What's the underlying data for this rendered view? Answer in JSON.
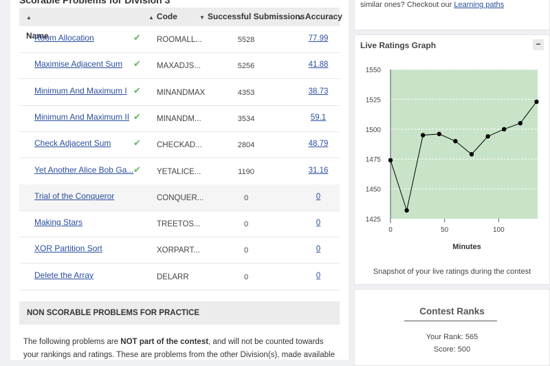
{
  "section_title": "Scorable Problems for Division 3",
  "table": {
    "headers": {
      "name": "Name",
      "code": "Code",
      "successful_submissions": "Successful Submissions",
      "accuracy": "Accuracy"
    },
    "rows": [
      {
        "name": "Room Allocation",
        "solved": true,
        "code": "ROOMALL...",
        "successful": "5528",
        "accuracy": "77.99"
      },
      {
        "name": "Maximise Adjacent Sum",
        "solved": true,
        "code": "MAXADJS...",
        "successful": "5256",
        "accuracy": "41.88"
      },
      {
        "name": "Minimum And Maximum I",
        "solved": true,
        "code": "MINANDMAX",
        "successful": "4353",
        "accuracy": "38.73"
      },
      {
        "name": "Minimum And Maximum II",
        "solved": true,
        "code": "MINANDM...",
        "successful": "3534",
        "accuracy": "59.1"
      },
      {
        "name": "Check Adjacent Sum",
        "solved": true,
        "code": "CHECKAD...",
        "successful": "2804",
        "accuracy": "48.79"
      },
      {
        "name": "Yet Another Alice Bob Ga...",
        "solved": true,
        "code": "YETALICE...",
        "successful": "1190",
        "accuracy": "31.16"
      },
      {
        "name": "Trial of the Conqueror",
        "solved": false,
        "code": "CONQUER...",
        "successful": "0",
        "accuracy": "0"
      },
      {
        "name": "Making Stars",
        "solved": false,
        "code": "TREETOS...",
        "successful": "0",
        "accuracy": "0"
      },
      {
        "name": "XOR Partition Sort",
        "solved": false,
        "code": "XORPART...",
        "successful": "0",
        "accuracy": "0"
      },
      {
        "name": "Delete the Array",
        "solved": false,
        "code": "DELARR",
        "successful": "0",
        "accuracy": "0"
      }
    ]
  },
  "non_scorable": {
    "title": "NON SCORABLE PROBLEMS FOR PRACTICE",
    "text_before": "The following problems are ",
    "text_bold": "NOT part of the contest",
    "text_after": ", and will not be counted towards your rankings and ratings. These are problems from the other Division(s), made available for you"
  },
  "learning": {
    "text": "similar ones? Checkout our ",
    "link": "Learning paths"
  },
  "ratings_graph": {
    "title": "Live Ratings Graph",
    "collapse_symbol": "−",
    "caption": "Snapshot of your live ratings during the contest",
    "colors": {
      "fill": "#c8e3c8",
      "line": "#000000"
    }
  },
  "chart_data": {
    "type": "line",
    "title": "Live Ratings Graph",
    "xlabel": "Minutes",
    "ylabel": "",
    "xlim": [
      0,
      136
    ],
    "ylim": [
      1425,
      1550
    ],
    "xticks": [
      0,
      50,
      100
    ],
    "yticks": [
      1425,
      1450,
      1475,
      1500,
      1525,
      1550
    ],
    "grid": true,
    "series": [
      {
        "x": [
          0,
          15,
          30,
          45,
          60,
          75,
          90,
          105,
          120,
          135
        ],
        "y": [
          1474,
          1432,
          1495,
          1496,
          1490,
          1479,
          1494,
          1500,
          1505,
          1523
        ]
      }
    ]
  },
  "contest_ranks": {
    "title": "Contest Ranks",
    "rank": "Your Rank: 565",
    "score": "Score: 500"
  }
}
